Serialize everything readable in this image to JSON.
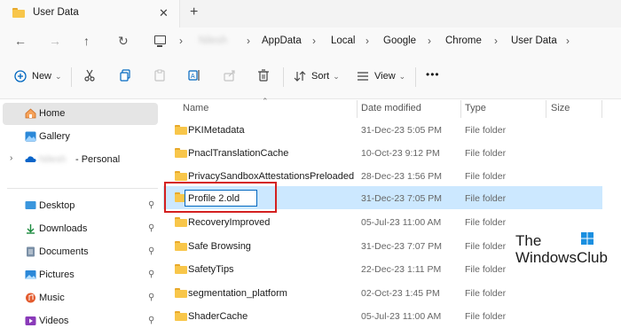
{
  "tab": {
    "title": "User Data",
    "close": "✕",
    "new_tab": "+"
  },
  "nav": {
    "back": "←",
    "forward": "→",
    "up": "↑",
    "refresh": "↻"
  },
  "breadcrumb": {
    "separator": "›",
    "items": [
      "Nilesh",
      "AppData",
      "Local",
      "Google",
      "Chrome",
      "User Data"
    ]
  },
  "toolbar": {
    "new_label": "New",
    "sort_label": "Sort",
    "view_label": "View",
    "more": "•••",
    "dropdown": "⌄",
    "icons": [
      "cut-icon",
      "copy-icon",
      "paste-icon",
      "rename-icon",
      "share-icon",
      "delete-icon"
    ]
  },
  "sidebar": {
    "items": [
      {
        "label": "Home",
        "icon": "home-icon"
      },
      {
        "label": "Gallery",
        "icon": "gallery-icon"
      },
      {
        "label": "- Personal",
        "account": "Nilesh",
        "icon": "onedrive-icon"
      },
      {
        "label": "Desktop",
        "icon": "desktop-icon"
      },
      {
        "label": "Downloads",
        "icon": "downloads-icon"
      },
      {
        "label": "Documents",
        "icon": "documents-icon"
      },
      {
        "label": "Pictures",
        "icon": "pictures-icon"
      },
      {
        "label": "Music",
        "icon": "music-icon"
      },
      {
        "label": "Videos",
        "icon": "videos-icon"
      }
    ],
    "pin": "📌"
  },
  "columns": {
    "name": "Name",
    "date": "Date modified",
    "type": "Type",
    "size": "Size"
  },
  "rows": [
    {
      "name": "PKIMetadata",
      "date": "31-Dec-23 5:05 PM",
      "type": "File folder"
    },
    {
      "name": "PnaclTranslationCache",
      "date": "10-Oct-23 9:12 PM",
      "type": "File folder"
    },
    {
      "name": "PrivacySandboxAttestationsPreloaded",
      "date": "28-Dec-23 1:56 PM",
      "type": "File folder"
    },
    {
      "name": "Profile 2.old",
      "date": "31-Dec-23 7:05 PM",
      "type": "File folder"
    },
    {
      "name": "RecoveryImproved",
      "date": "05-Jul-23 11:00 AM",
      "type": "File folder"
    },
    {
      "name": "Safe Browsing",
      "date": "31-Dec-23 7:07 PM",
      "type": "File folder"
    },
    {
      "name": "SafetyTips",
      "date": "22-Dec-23 1:11 PM",
      "type": "File folder"
    },
    {
      "name": "segmentation_platform",
      "date": "02-Oct-23 1:45 PM",
      "type": "File folder"
    },
    {
      "name": "ShaderCache",
      "date": "05-Jul-23 11:00 AM",
      "type": "File folder"
    }
  ],
  "watermark": {
    "line1": "The",
    "line2": "WindowsClub"
  },
  "colors": {
    "selection": "#cce8ff",
    "accent": "#0067c0",
    "highlight": "#d42020",
    "folder": "#f8c64a"
  }
}
